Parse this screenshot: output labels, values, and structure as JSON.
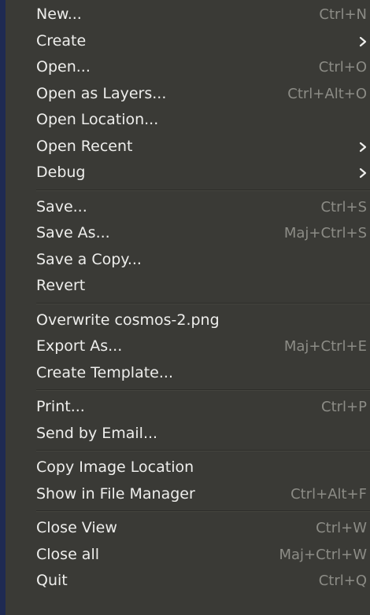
{
  "menu": {
    "groups": [
      [
        {
          "label": "New...",
          "shortcut": "Ctrl+N"
        },
        {
          "label": "Create",
          "submenu": true
        },
        {
          "label": "Open...",
          "shortcut": "Ctrl+O"
        },
        {
          "label": "Open as Layers...",
          "shortcut": "Ctrl+Alt+O"
        },
        {
          "label": "Open Location..."
        },
        {
          "label": "Open Recent",
          "submenu": true
        },
        {
          "label": "Debug",
          "submenu": true
        }
      ],
      [
        {
          "label": "Save...",
          "shortcut": "Ctrl+S"
        },
        {
          "label": "Save As...",
          "shortcut": "Maj+Ctrl+S"
        },
        {
          "label": "Save a Copy..."
        },
        {
          "label": "Revert"
        }
      ],
      [
        {
          "label": "Overwrite cosmos-2.png"
        },
        {
          "label": "Export As...",
          "shortcut": "Maj+Ctrl+E"
        },
        {
          "label": "Create Template..."
        }
      ],
      [
        {
          "label": "Print...",
          "shortcut": "Ctrl+P"
        },
        {
          "label": "Send by Email..."
        }
      ],
      [
        {
          "label": "Copy Image Location"
        },
        {
          "label": "Show in File Manager",
          "shortcut": "Ctrl+Alt+F"
        }
      ],
      [
        {
          "label": "Close View",
          "shortcut": "Ctrl+W"
        },
        {
          "label": "Close all",
          "shortcut": "Maj+Ctrl+W"
        },
        {
          "label": "Quit",
          "shortcut": "Ctrl+Q"
        }
      ]
    ],
    "colors": {
      "background": "#3a3a36",
      "text": "#eeeeec",
      "shortcut": "#8c8c86",
      "left_edge": "#1f2a52"
    },
    "icons": {
      "submenu": "chevron-right-icon"
    }
  }
}
